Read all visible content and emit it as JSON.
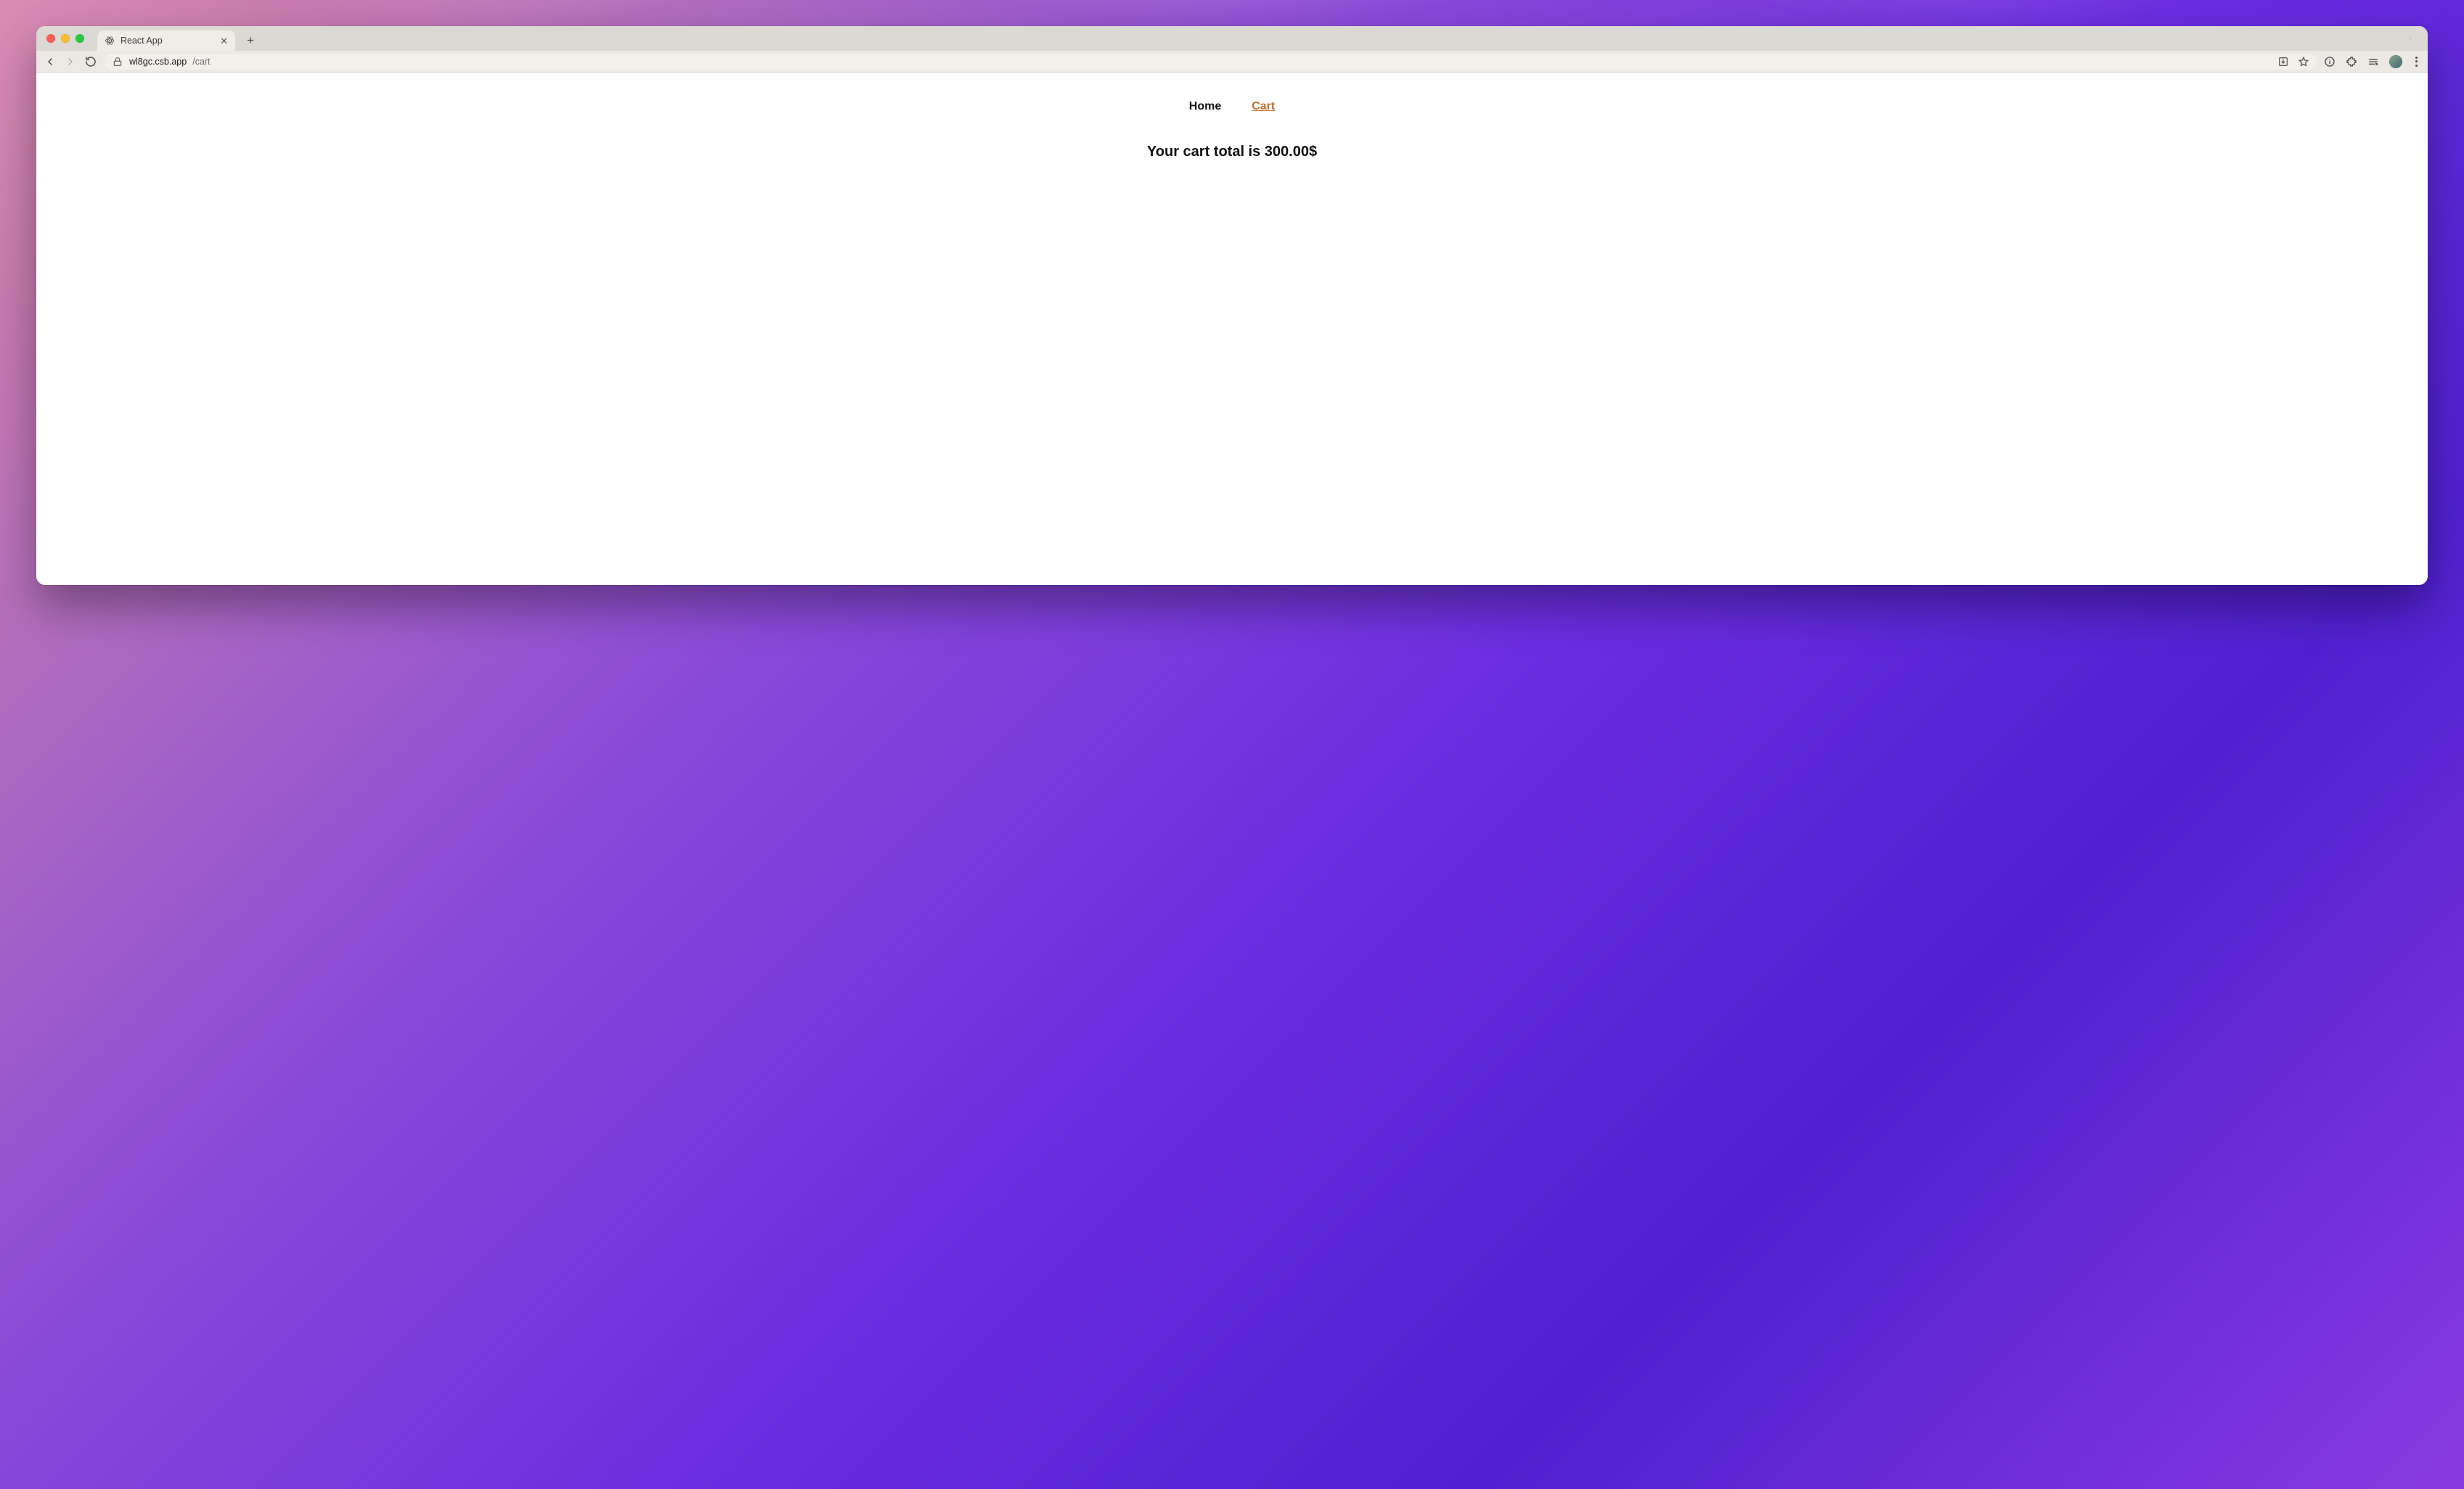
{
  "browser": {
    "tab": {
      "title": "React App"
    },
    "address": {
      "host": "wl8gc.csb.app",
      "path": "/cart"
    }
  },
  "nav": {
    "home_label": "Home",
    "cart_label": "Cart"
  },
  "cart": {
    "total_text": "Your cart total is 300.00$"
  }
}
